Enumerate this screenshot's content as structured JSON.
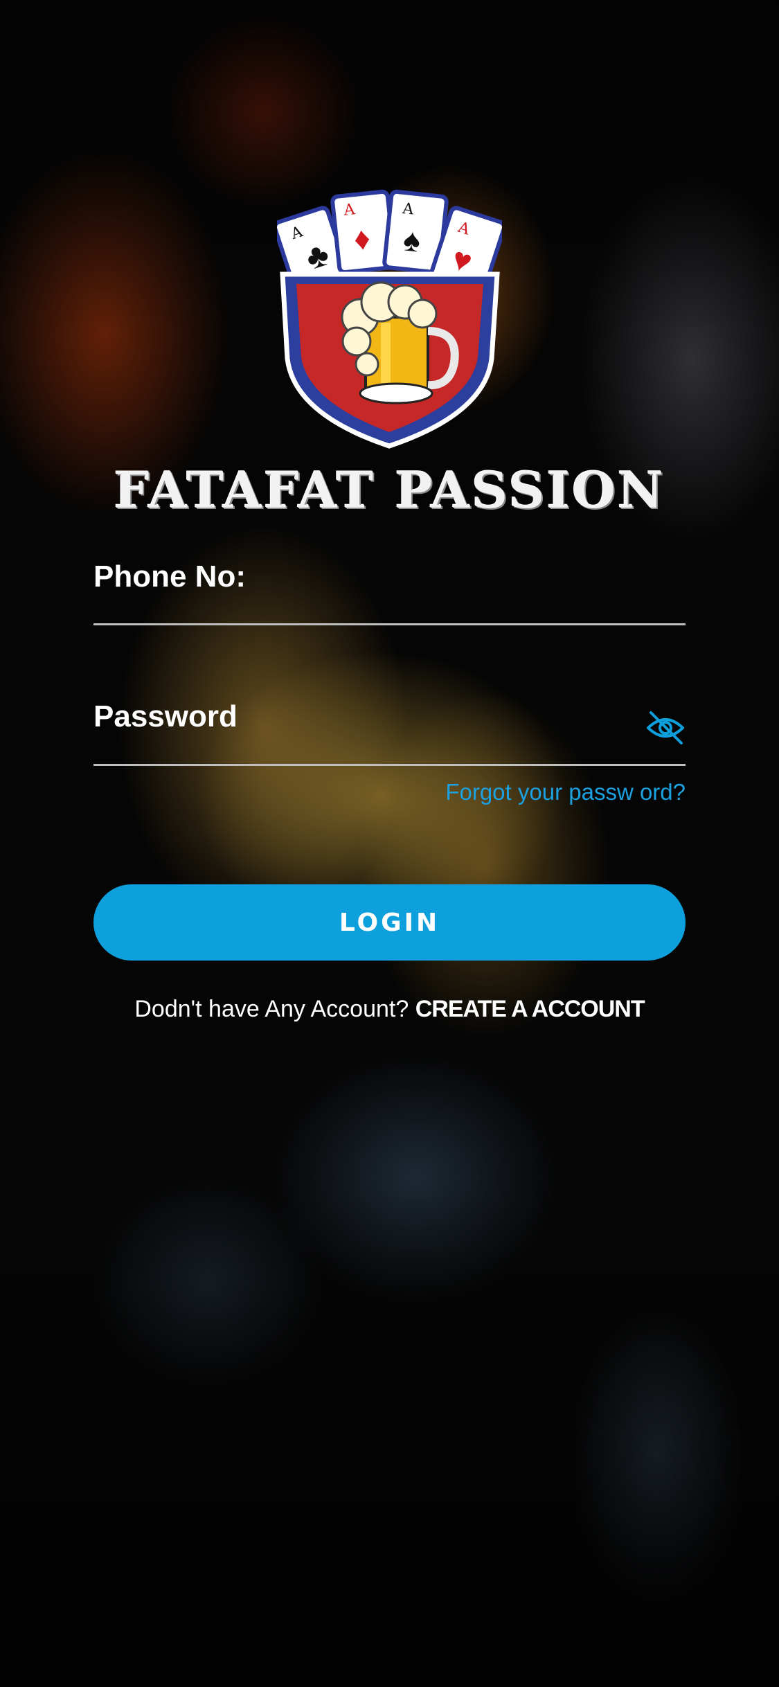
{
  "brand": {
    "name": "FATAFAT PASSION",
    "logo_icon": "cards-beer-shield-logo"
  },
  "form": {
    "phone_label": "Phone No:",
    "phone_value": "",
    "password_label": "Password",
    "password_value": "",
    "password_toggle_icon": "eye-off-icon",
    "forgot_link": "Forgot your passw ord?",
    "login_button": "LOGIN"
  },
  "signup": {
    "prompt": "Dodn't have Any Account?",
    "link": "CREATE A ACCOUNT"
  },
  "colors": {
    "accent": "#0ea0dc",
    "link": "#1ba1e0",
    "text": "#ffffff",
    "underline": "#bfbfbf"
  }
}
